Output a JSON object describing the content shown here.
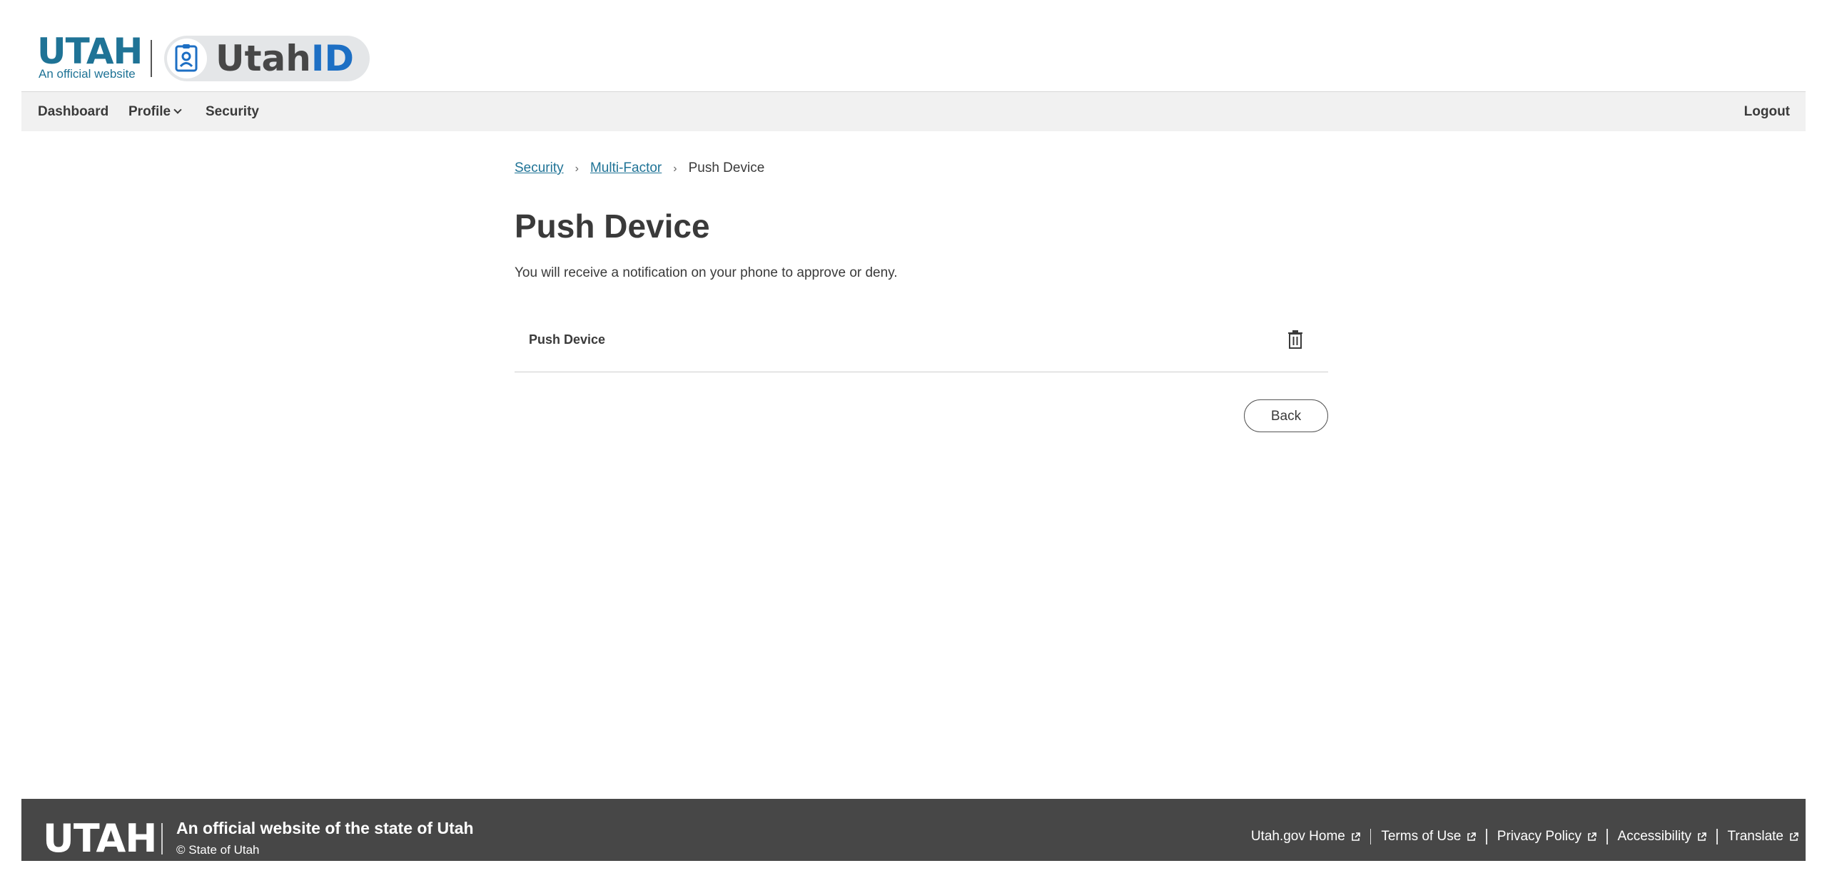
{
  "header": {
    "utah_word": "UTAH",
    "utah_subtitle": "An official website",
    "app_name_prefix": "Utah",
    "app_name_suffix": "ID",
    "icons": {
      "utahid": "id-badge-icon"
    },
    "colors": {
      "utah_blue": "#1f7396",
      "id_blue": "#1d6fc4"
    }
  },
  "nav": {
    "dashboard": "Dashboard",
    "profile": "Profile",
    "security": "Security",
    "logout": "Logout"
  },
  "breadcrumb": {
    "items": [
      "Security",
      "Multi-Factor"
    ],
    "separator": "›",
    "current": "Push Device"
  },
  "main": {
    "title": "Push Device",
    "description": "You will receive a notification on your phone to approve or deny.",
    "device": {
      "name": "Push Device",
      "delete_icon": "trash-icon"
    },
    "back_label": "Back"
  },
  "footer": {
    "utah_word": "UTAH",
    "official_text": "An official website of the state of Utah",
    "copyright": "© State of Utah",
    "links": [
      "Utah.gov Home",
      "Terms of Use",
      "Privacy Policy",
      "Accessibility",
      "Translate"
    ],
    "link_icon": "external-link-icon",
    "background": "#474747"
  }
}
